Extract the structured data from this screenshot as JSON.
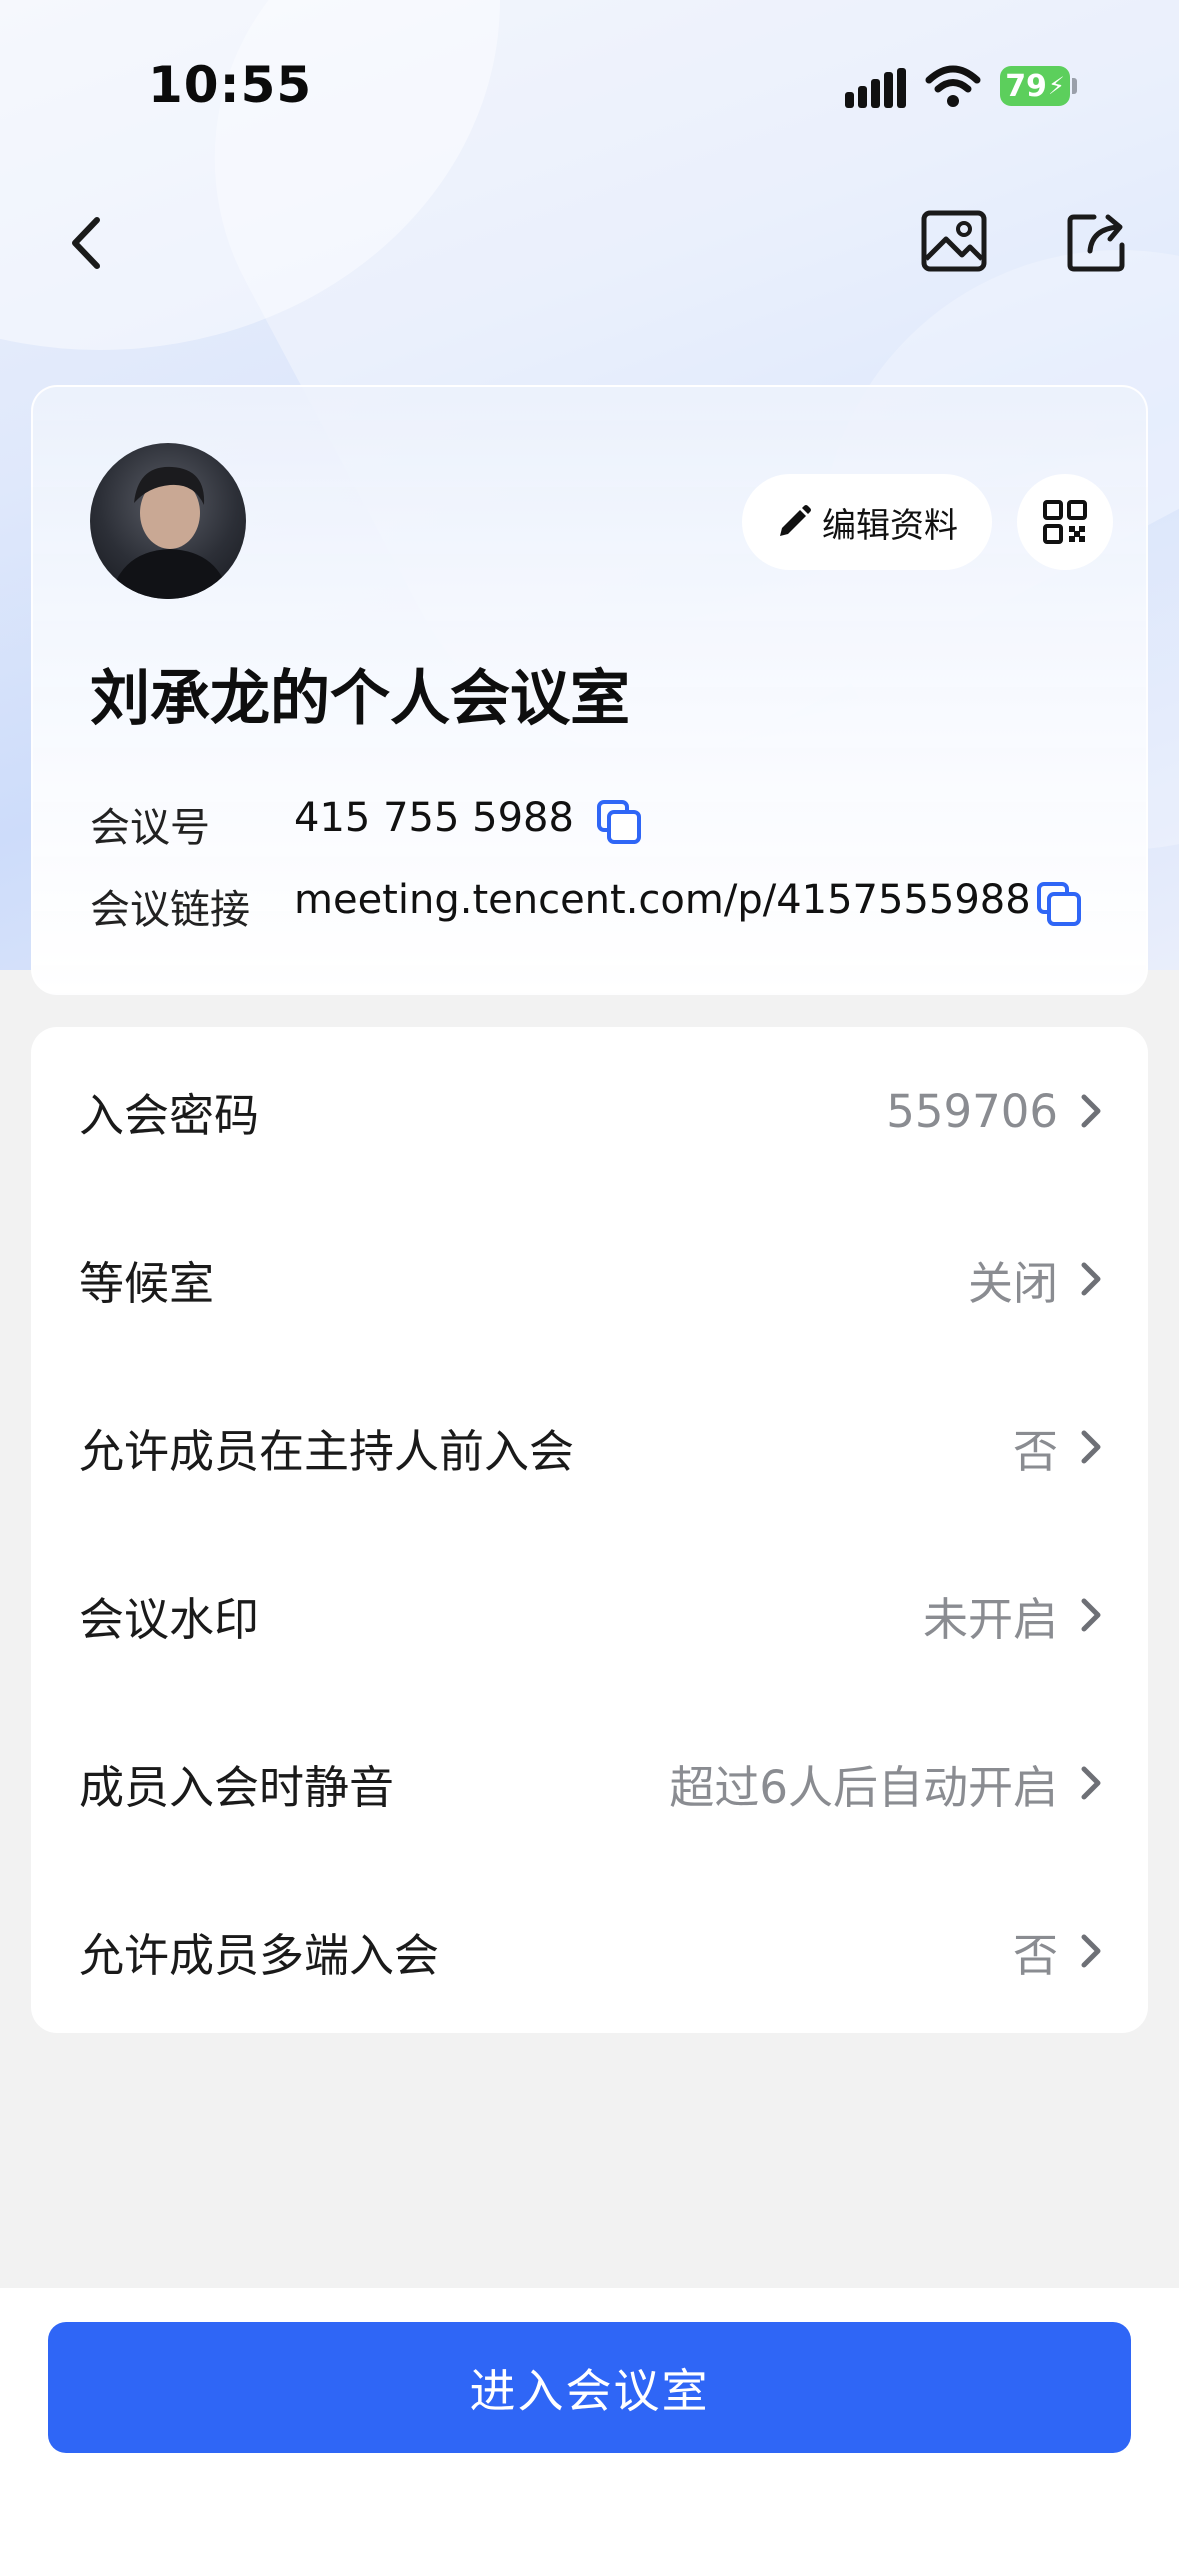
{
  "status_bar": {
    "time": "10:55",
    "battery": "79"
  },
  "profile": {
    "edit_label": "编辑资料",
    "room_title": "刘承龙的个人会议室",
    "meeting_id_label": "会议号",
    "meeting_id": "415 755 5988",
    "link_label": "会议链接",
    "link": "meeting.tencent.com/p/4157555988"
  },
  "settings": {
    "rows": [
      {
        "label": "入会密码",
        "value": "559706"
      },
      {
        "label": "等候室",
        "value": "关闭"
      },
      {
        "label": "允许成员在主持人前入会",
        "value": "否"
      },
      {
        "label": "会议水印",
        "value": "未开启"
      },
      {
        "label": "成员入会时静音",
        "value": "超过6人后自动开启"
      },
      {
        "label": "允许成员多端入会",
        "value": "否"
      }
    ]
  },
  "bottom": {
    "enter_button": "进入会议室"
  },
  "colors": {
    "accent": "#2f66f6",
    "copy_icon": "#2f66f6",
    "battery": "#5ccf5c"
  }
}
